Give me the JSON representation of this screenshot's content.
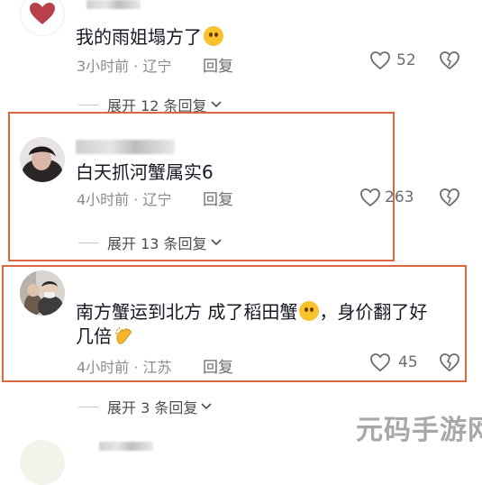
{
  "comments": [
    {
      "text": "我的雨姐塌方了",
      "time": "3小时前",
      "location": "辽宁",
      "reply_label": "回复",
      "likes": "52",
      "expand_label": "展开 12 条回复"
    },
    {
      "text": "白天抓河蟹属实6",
      "time": "4小时前",
      "location": "辽宁",
      "reply_label": "回复",
      "likes": "263",
      "expand_label": "展开 13 条回复"
    },
    {
      "text_line1": "南方蟹运到北方  成了稻田蟹",
      "text_line1_tail": "，身价翻了好",
      "text_line2": "几倍",
      "time": "4小时前",
      "location": "江苏",
      "reply_label": "回复",
      "likes": "45",
      "expand_label": "展开 3 条回复"
    }
  ],
  "meta_separator": "·",
  "watermark": "元码手游网",
  "colors": {
    "highlight_box": "#d9673f",
    "like_icon": "#6b6c72",
    "heart_avatar": "#b8404a"
  }
}
